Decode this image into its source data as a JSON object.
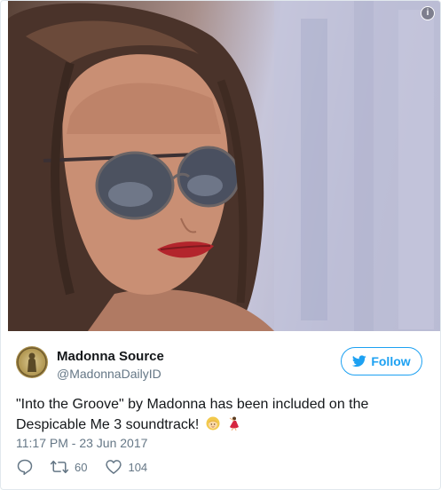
{
  "media": {
    "info_icon": "info-icon"
  },
  "user": {
    "name": "Madonna Source",
    "handle": "@MadonnaDailyID",
    "avatar_icon": "avatar-medallion-icon"
  },
  "follow_button": {
    "label": "Follow",
    "icon": "bird-icon"
  },
  "tweet": {
    "text": "\"Into the Groove\" by Madonna has been included on the Despicable Me 3 soundtrack!",
    "emojis": [
      "blonde-woman-emoji",
      "dancer-emoji"
    ],
    "timestamp": "11:17 PM - 23 Jun 2017"
  },
  "actions": {
    "reply_icon": "reply-icon",
    "retweet_icon": "retweet-icon",
    "retweet_count": "60",
    "like_icon": "heart-icon",
    "like_count": "104"
  },
  "colors": {
    "accent": "#1da1f2",
    "secondary_text": "#657786",
    "primary_text": "#14171a",
    "border": "#e1e8ed"
  }
}
